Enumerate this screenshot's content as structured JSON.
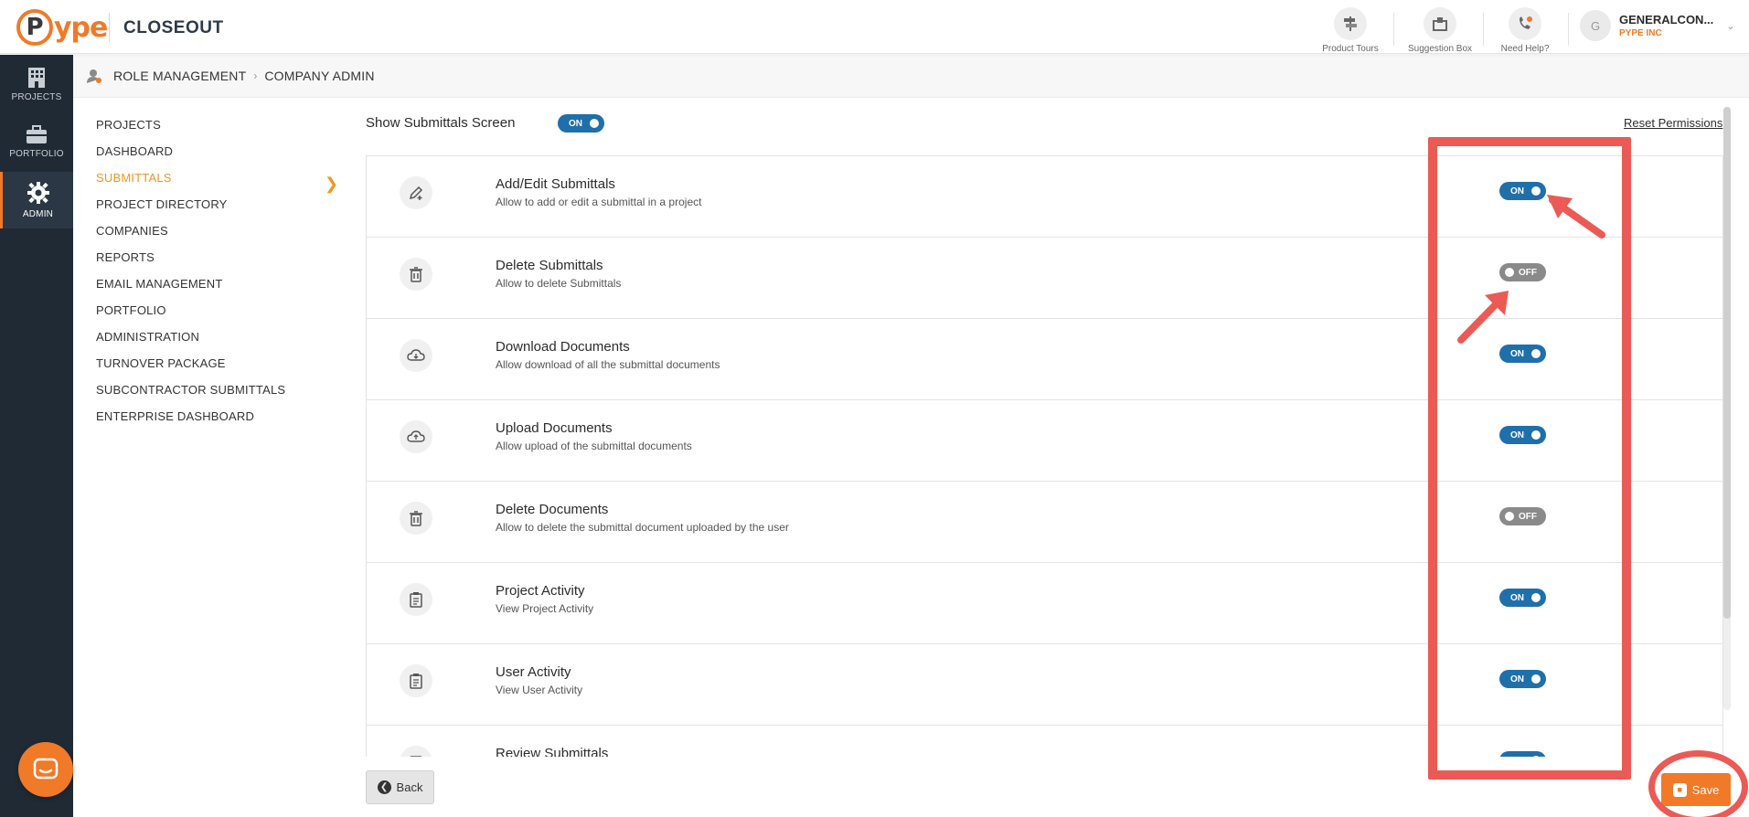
{
  "header": {
    "logo_mark": "P",
    "logo_text": "ype",
    "app_title": "CLOSEOUT",
    "tools": [
      {
        "label": "Product Tours",
        "icon": "signpost-icon"
      },
      {
        "label": "Suggestion Box",
        "icon": "suggestion-box-icon"
      },
      {
        "label": "Need Help?",
        "icon": "help-phone-icon"
      }
    ],
    "user": {
      "initial": "G",
      "name": "GENERALCON...",
      "company": "PYPE INC"
    }
  },
  "leftnav": {
    "items": [
      {
        "label": "PROJECTS",
        "icon": "building-icon",
        "active": false
      },
      {
        "label": "PORTFOLIO",
        "icon": "briefcase-icon",
        "active": false
      },
      {
        "label": "ADMIN",
        "icon": "gear-icon",
        "active": true
      }
    ]
  },
  "breadcrumb": {
    "items": [
      "ROLE MANAGEMENT",
      "COMPANY ADMIN"
    ]
  },
  "modules": {
    "items": [
      {
        "label": "PROJECTS",
        "active": false
      },
      {
        "label": "DASHBOARD",
        "active": false
      },
      {
        "label": "SUBMITTALS",
        "active": true
      },
      {
        "label": "PROJECT DIRECTORY",
        "active": false
      },
      {
        "label": "COMPANIES",
        "active": false
      },
      {
        "label": "REPORTS",
        "active": false
      },
      {
        "label": "EMAIL MANAGEMENT",
        "active": false
      },
      {
        "label": "PORTFOLIO",
        "active": false
      },
      {
        "label": "ADMINISTRATION",
        "active": false
      },
      {
        "label": "TURNOVER PACKAGE",
        "active": false
      },
      {
        "label": "SUBCONTRACTOR SUBMITTALS",
        "active": false
      },
      {
        "label": "ENTERPRISE DASHBOARD",
        "active": false
      }
    ]
  },
  "main": {
    "show_screen_label": "Show Submittals Screen",
    "show_screen_state": "ON",
    "reset_label": "Reset Permissions",
    "permissions": [
      {
        "title": "Add/Edit Submittals",
        "desc": "Allow to add or edit a submittal in a project",
        "state": "ON",
        "icon": "edit-pencil-icon"
      },
      {
        "title": "Delete Submittals",
        "desc": "Allow to delete Submittals",
        "state": "OFF",
        "icon": "trash-icon"
      },
      {
        "title": "Download Documents",
        "desc": "Allow download of all the submittal documents",
        "state": "ON",
        "icon": "cloud-download-icon"
      },
      {
        "title": "Upload Documents",
        "desc": "Allow upload of the submittal documents",
        "state": "ON",
        "icon": "cloud-upload-icon"
      },
      {
        "title": "Delete Documents",
        "desc": "Allow to delete the submittal document uploaded by the user",
        "state": "OFF",
        "icon": "trash-icon"
      },
      {
        "title": "Project Activity",
        "desc": "View Project Activity",
        "state": "ON",
        "icon": "clipboard-icon"
      },
      {
        "title": "User Activity",
        "desc": "View User Activity",
        "state": "ON",
        "icon": "clipboard-icon"
      },
      {
        "title": "Review Submittals",
        "desc": "",
        "state": "ON",
        "icon": "review-icon"
      }
    ],
    "back_label": "Back",
    "save_label": "Save"
  },
  "colors": {
    "brand_orange": "#f07a28",
    "toggle_on": "#1f6fab",
    "toggle_off": "#8a8a8a",
    "sidebar_dark": "#1f2a35",
    "annotation_red": "#ec5a55"
  }
}
